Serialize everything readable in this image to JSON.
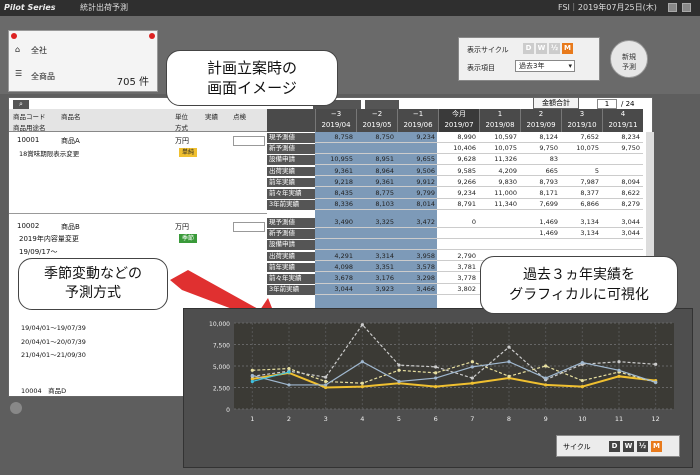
{
  "titlebar": {
    "logo": "Pilot Series",
    "title": "統計出荷予測",
    "server": "FSI",
    "datetime": "2019年07月25日(木)"
  },
  "summary": {
    "company": "全社",
    "all_products": "全商品",
    "count": "705 件"
  },
  "settings": {
    "cycle_label": "表示サイクル",
    "item_label": "表示項目",
    "item_value": "過去3年",
    "cycles": [
      "D",
      "W",
      "½",
      "M"
    ]
  },
  "new_button": {
    "line1": "新規",
    "line2": "予測"
  },
  "nav": {
    "amount_total": "金額合計",
    "page": "1",
    "page_total": "/ 24"
  },
  "columns": {
    "code": "商品コード",
    "name": "商品名",
    "group": "商品用途名",
    "unit": "単位",
    "method": "方式",
    "actual": "実績",
    "check": "点検"
  },
  "months": [
    {
      "offset": "−3",
      "month": "2019/04"
    },
    {
      "offset": "−2",
      "month": "2019/05"
    },
    {
      "offset": "−1",
      "month": "2019/06"
    },
    {
      "offset": "今月",
      "month": "2019/07"
    },
    {
      "offset": "1",
      "month": "2019/08"
    },
    {
      "offset": "2",
      "month": "2019/09"
    },
    {
      "offset": "3",
      "month": "2019/10"
    },
    {
      "offset": "4",
      "month": "2019/11"
    }
  ],
  "row_labels": [
    "現予測値",
    "新予測値",
    "設備申請",
    "出荷実績",
    "前年実績",
    "前々年実績",
    "3年前実績"
  ],
  "products": [
    {
      "code": "10001",
      "name": "商品A",
      "unit": "万円",
      "badge": "単純",
      "note": "18賞味期限表示変更",
      "date": ""
    },
    {
      "code": "10002",
      "name": "商品B",
      "unit": "万円",
      "badge": "季節",
      "note": "2019年内容量変更",
      "date": "19/09/17〜"
    }
  ],
  "product1_values": [
    [
      "8,758",
      "8,750",
      "9,234",
      "8,990",
      "10,597",
      "8,124",
      "7,652",
      "8,234"
    ],
    [
      "",
      "",
      "",
      "10,406",
      "10,075",
      "9,750",
      "10,075",
      "9,750"
    ],
    [
      "10,955",
      "8,951",
      "9,655",
      "9,628",
      "11,326",
      "83",
      "",
      ""
    ],
    [
      "9,361",
      "8,964",
      "9,506",
      "9,585",
      "4,209",
      "665",
      "5",
      ""
    ],
    [
      "9,218",
      "9,361",
      "9,912",
      "9,266",
      "9,830",
      "8,793",
      "7,987",
      "8,094"
    ],
    [
      "8,435",
      "8,775",
      "9,799",
      "9,234",
      "11,000",
      "8,171",
      "8,377",
      "8,622"
    ],
    [
      "8,336",
      "8,103",
      "8,014",
      "8,791",
      "11,340",
      "7,699",
      "6,866",
      "8,279"
    ]
  ],
  "product2_values": [
    [
      "3,490",
      "3,325",
      "3,472",
      "0",
      "",
      "1,469",
      "3,134",
      "3,044"
    ],
    [
      "",
      "",
      "",
      "",
      "",
      "1,469",
      "3,134",
      "3,044"
    ],
    [
      "",
      "",
      "",
      "",
      "",
      "",
      "",
      ""
    ],
    [
      "4,291",
      "3,314",
      "3,958",
      "2,790",
      "",
      "",
      "",
      ""
    ],
    [
      "4,098",
      "3,351",
      "3,578",
      "3,781",
      "",
      "",
      "",
      ""
    ],
    [
      "3,678",
      "3,176",
      "3,298",
      "3,778",
      "",
      "",
      "",
      ""
    ],
    [
      "3,044",
      "3,923",
      "3,466",
      "3,802",
      "",
      "",
      "",
      ""
    ]
  ],
  "seasons": [
    "19/04/01〜19/07/39",
    "20/04/01〜20/07/39",
    "21/04/01〜21/09/30"
  ],
  "product3_label": "10004　商品D",
  "callouts": {
    "top": "計画立案時の\n画面イメージ",
    "left": "季節変動などの\n予測方式",
    "right": "過去３ヵ年実績を\nグラフィカルに可視化"
  },
  "chart_data": {
    "type": "line",
    "x": [
      1,
      2,
      3,
      4,
      5,
      6,
      7,
      8,
      9,
      10,
      11,
      12
    ],
    "ylim": [
      0,
      10000
    ],
    "yticks": [
      "10,000",
      "7,500",
      "5,000",
      "2,500",
      "0"
    ],
    "xlabels": [
      "1",
      "2",
      "3",
      "4",
      "5",
      "6",
      "7",
      "8",
      "9",
      "10",
      "11",
      "12"
    ],
    "grid": true,
    "series": [
      {
        "color": "#f0c030",
        "values": [
          3500,
          4200,
          2500,
          2600,
          3000,
          2600,
          3000,
          3600,
          2800,
          2600,
          3800,
          3300
        ]
      },
      {
        "color": "#e8e0a0",
        "values": [
          4500,
          4700,
          3200,
          3000,
          4500,
          4200,
          5500,
          3800,
          5000,
          3300,
          4300,
          3100
        ]
      },
      {
        "color": "#cccccc",
        "values": [
          3800,
          4400,
          3700,
          9800,
          5100,
          4900,
          3600,
          7200,
          3400,
          5200,
          5500,
          5200
        ]
      },
      {
        "color": "#a0b8d0",
        "values": [
          3900,
          2800,
          2800,
          5500,
          3200,
          3600,
          4900,
          5500,
          3600,
          5400,
          4500,
          3100
        ]
      },
      {
        "color": "#40c0e0",
        "values": [
          3200,
          4300,
          null,
          null,
          null,
          null,
          null,
          null,
          null,
          null,
          null,
          null
        ]
      }
    ]
  },
  "cycle_bar": {
    "label": "サイクル",
    "buttons": [
      "D",
      "W",
      "½",
      "M"
    ]
  }
}
